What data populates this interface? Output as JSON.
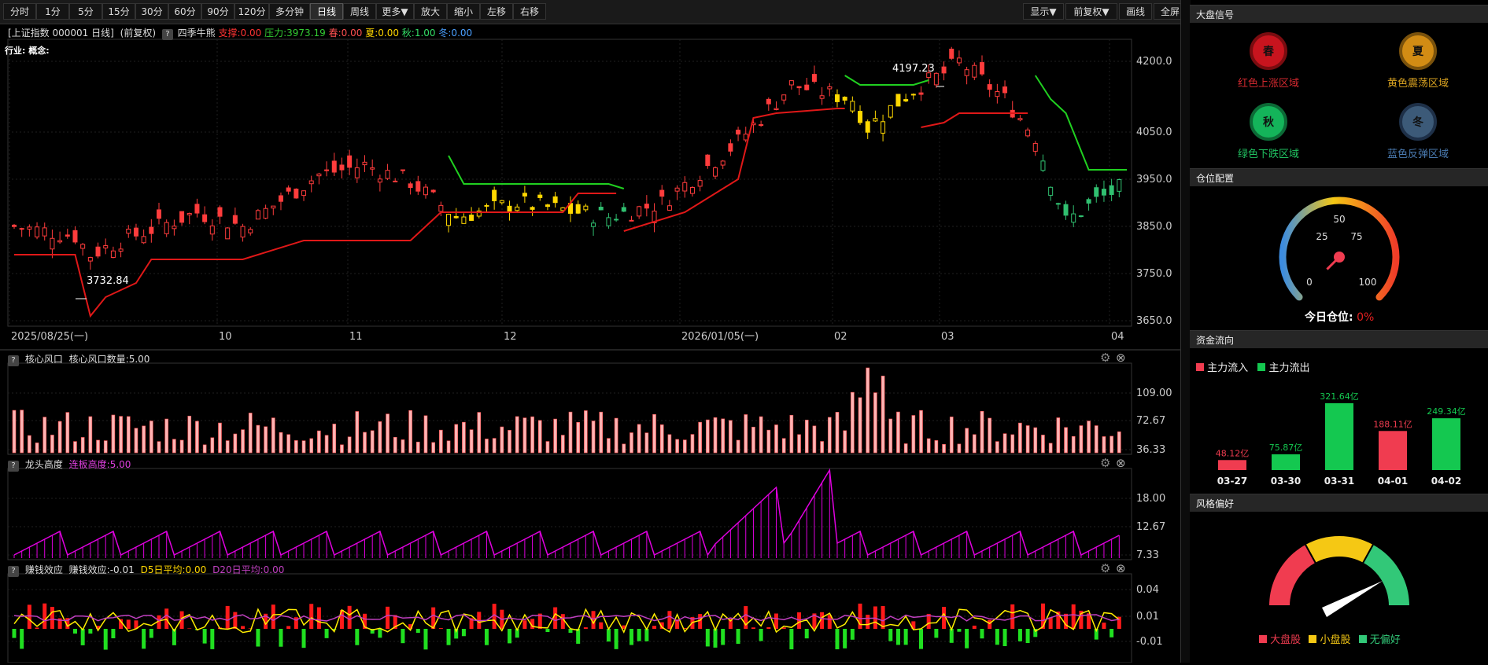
{
  "toolbar": {
    "periods": [
      "分时",
      "1分",
      "5分",
      "15分",
      "30分",
      "60分",
      "90分",
      "120分",
      "多分钟",
      "日线",
      "周线",
      "更多▼",
      "放大",
      "缩小",
      "左移",
      "右移"
    ],
    "active": "日线",
    "right": [
      "显示▼",
      "前复权▼",
      "画线",
      "全屏"
    ]
  },
  "main_chart": {
    "header": "[上证指数 000001 日线]",
    "adjust": "(前复权)",
    "question": "?",
    "indicator": "四季牛熊",
    "support": "支撑:0.00",
    "pressure": "压力:3973.19",
    "spring": "春:0.00",
    "summer": "夏:0.00",
    "autumn": "秋:1.00",
    "winter": "冬:0.00",
    "industry_label": "行业: 概念:",
    "high_label": "4197.23",
    "low_label": "3732.84",
    "y_ticks": [
      "4200.0",
      "4050.0",
      "3950.0",
      "3850.0",
      "3750.0",
      "3650.0"
    ],
    "x_ticks": [
      "2025/08/25(一)",
      "10",
      "11",
      "12",
      "2026/01/05(一)",
      "02",
      "03",
      "04"
    ]
  },
  "sub1": {
    "q": "?",
    "title": "核心风口",
    "label": "核心风口数量:5.00",
    "y_ticks": [
      "109.00",
      "72.67",
      "36.33"
    ]
  },
  "sub2": {
    "q": "?",
    "title": "龙头高度",
    "label": "连板高度:5.00",
    "y_ticks": [
      "18.00",
      "12.67",
      "7.33"
    ]
  },
  "sub3": {
    "q": "?",
    "title": "赚钱效应",
    "label": "赚钱效应:-0.01",
    "d5": "D5日平均:0.00",
    "d20": "D20日平均:0.00",
    "y_ticks": [
      "0.04",
      "0.01",
      "-0.01"
    ]
  },
  "panels": {
    "signal": {
      "title": "大盘信号",
      "items": [
        {
          "glyph": "春",
          "label": "红色上涨区域",
          "color": "#c8141e",
          "text": "#d0282e"
        },
        {
          "glyph": "夏",
          "label": "黄色震荡区域",
          "color": "#d28c14",
          "text": "#d6a020"
        },
        {
          "glyph": "秋",
          "label": "绿色下跌区域",
          "color": "#14b45a",
          "text": "#20c060"
        },
        {
          "glyph": "冬",
          "label": "蓝色反弹区域",
          "color": "#3c5a78",
          "text": "#4a7ab0"
        }
      ]
    },
    "position": {
      "title": "仓位配置",
      "ticks": [
        "0",
        "25",
        "50",
        "75",
        "100"
      ],
      "label": "今日仓位:",
      "value": "0%",
      "fraction": 0.0
    },
    "flow": {
      "title": "资金流向",
      "legend_in": "主力流入",
      "legend_out": "主力流出",
      "bars": [
        {
          "date": "03-27",
          "label": "48.12亿",
          "value": 48.12,
          "dir": "in"
        },
        {
          "date": "03-30",
          "label": "75.87亿",
          "value": 75.87,
          "dir": "out"
        },
        {
          "date": "03-31",
          "label": "321.64亿",
          "value": 321.64,
          "dir": "out"
        },
        {
          "date": "04-01",
          "label": "188.11亿",
          "value": 188.11,
          "dir": "in"
        },
        {
          "date": "04-02",
          "label": "249.34亿",
          "value": 249.34,
          "dir": "out"
        }
      ]
    },
    "style": {
      "title": "风格偏好",
      "legend": [
        "大盘股",
        "小盘股",
        "无偏好"
      ],
      "colors": [
        "#f03c50",
        "#f5c814",
        "#32c878"
      ]
    }
  }
}
